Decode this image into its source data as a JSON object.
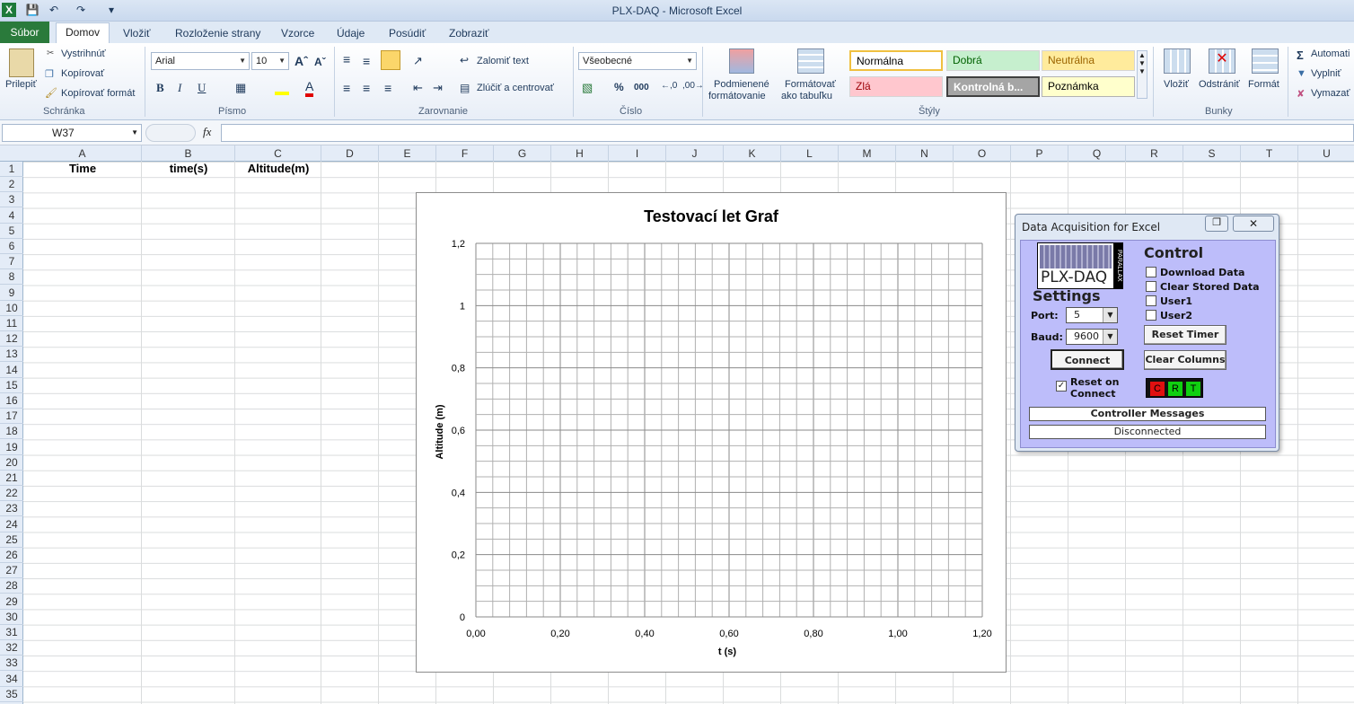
{
  "window": {
    "title": "PLX-DAQ  -  Microsoft Excel"
  },
  "ribbon_tabs": [
    "Súbor",
    "Domov",
    "Vložiť",
    "Rozloženie strany",
    "Vzorce",
    "Údaje",
    "Posúdiť",
    "Zobraziť"
  ],
  "clipboard": {
    "paste": "Prilepiť",
    "cut": "Vystrihnúť",
    "copy": "Kopírovať",
    "format_painter": "Kopírovať formát",
    "group": "Schránka"
  },
  "font": {
    "name": "Arial",
    "size": "10",
    "group": "Písmo",
    "bold": "B",
    "italic": "I",
    "underline": "U"
  },
  "alignment": {
    "wrap": "Zalomiť text",
    "merge": "Zlúčiť a centrovať",
    "group": "Zarovnanie"
  },
  "number": {
    "format": "Všeobecné",
    "group": "Číslo",
    "percent": "%",
    "thousands": "000"
  },
  "styles": {
    "cond_format": [
      "Podmienené",
      "formátovanie"
    ],
    "table_format": [
      "Formátovať",
      "ako tabuľku"
    ],
    "group": "Štýly",
    "cells": [
      {
        "label": "Normálna",
        "bg": "#ffffff",
        "fg": "#000000"
      },
      {
        "label": "Dobrá",
        "bg": "#c6efce",
        "fg": "#006100"
      },
      {
        "label": "Neutrálna",
        "bg": "#ffeb9c",
        "fg": "#9c6500"
      },
      {
        "label": "Zlá",
        "bg": "#ffc7ce",
        "fg": "#9c0006"
      },
      {
        "label": "Kontrolná b...",
        "bg": "#a5a5a5",
        "fg": "#ffffff"
      },
      {
        "label": "Poznámka",
        "bg": "#ffffcc",
        "fg": "#000000"
      }
    ]
  },
  "cells_group": {
    "insert": "Vložiť",
    "delete": "Odstrániť",
    "format": "Formát",
    "group": "Bunky"
  },
  "editing": {
    "autosum": "Automati",
    "fill": "Vyplniť",
    "clear": "Vymazať"
  },
  "formula_bar": {
    "name_box": "W37",
    "fx": "fx",
    "formula": ""
  },
  "columns": [
    "A",
    "B",
    "C",
    "D",
    "E",
    "F",
    "G",
    "H",
    "I",
    "J",
    "K",
    "L",
    "M",
    "N",
    "O",
    "P",
    "Q",
    "R",
    "S",
    "T",
    "U"
  ],
  "rows": [
    "1",
    "2",
    "3",
    "4",
    "5",
    "6",
    "7",
    "8",
    "9",
    "10",
    "11",
    "12",
    "13",
    "14",
    "15",
    "16",
    "17",
    "18",
    "19",
    "20",
    "21",
    "22",
    "23",
    "24",
    "25",
    "26",
    "27",
    "28",
    "29",
    "30",
    "31",
    "32",
    "33",
    "34",
    "35"
  ],
  "sheet": {
    "A1": "Time",
    "B1": "time(s)",
    "C1": "Altitude(m)"
  },
  "chart_data": {
    "type": "scatter",
    "title": "Testovací let Graf",
    "xlabel": "t (s)",
    "ylabel": "Altitude (m)",
    "xlim": [
      0,
      1.2
    ],
    "ylim": [
      0,
      1.2
    ],
    "x_ticks": [
      "0,00",
      "0,20",
      "0,40",
      "0,60",
      "0,80",
      "1,00",
      "1,20"
    ],
    "y_ticks": [
      "0",
      "0,2",
      "0,4",
      "0,6",
      "0,8",
      "1",
      "1,2"
    ],
    "grid": true,
    "series": []
  },
  "plx": {
    "window_title": "Data Acquisition for Excel",
    "logo_text": "PLX-DAQ",
    "logo_side": "PARALLAX",
    "settings_label": "Settings",
    "port_label": "Port:",
    "port_value": "5",
    "baud_label": "Baud:",
    "baud_value": "9600",
    "connect": "Connect",
    "reset_on_connect": "Reset on Connect",
    "control_label": "Control",
    "checks": [
      "Download Data",
      "Clear Stored Data",
      "User1",
      "User2"
    ],
    "reset_timer": "Reset Timer",
    "clear_columns": "Clear Columns",
    "indicators": [
      {
        "label": "C",
        "color": "#e01010"
      },
      {
        "label": "R",
        "color": "#10d010"
      },
      {
        "label": "T",
        "color": "#10d010"
      }
    ],
    "messages_label": "Controller Messages",
    "status": "Disconnected"
  }
}
